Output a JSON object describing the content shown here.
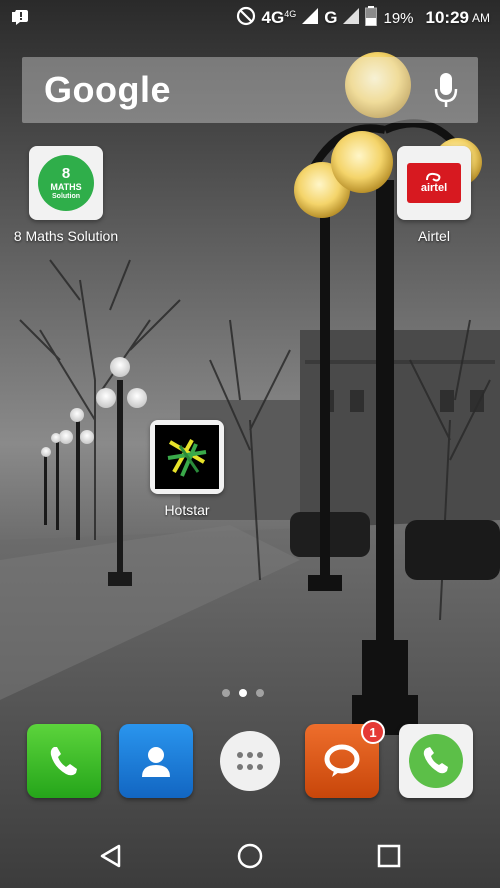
{
  "status_bar": {
    "network_4g_small": "4G",
    "network_4g_superscript": "4G",
    "network_g": "G",
    "battery_percent": "19%",
    "time": "10:29",
    "ampm": "AM"
  },
  "search": {
    "brand": "Google"
  },
  "apps": {
    "maths": {
      "label": "8 Maths Solution",
      "icon_number": "8",
      "icon_text1": "MATHS",
      "icon_text2": "Solution"
    },
    "airtel": {
      "label": "Airtel",
      "icon_text": "airtel"
    },
    "hotstar": {
      "label": "Hotstar"
    }
  },
  "dock": {
    "messages_badge": "1"
  },
  "colors": {
    "maths_green": "#2fae4a",
    "airtel_red": "#d71920",
    "phone_green": "#36b52c",
    "contacts_blue": "#1e7fd6",
    "messages_orange": "#e05a16",
    "call_app_green": "#5cbf48"
  },
  "icons": [
    "notification-icon",
    "dnd-icon",
    "signal-icon",
    "battery-icon",
    "mic-icon",
    "phone-icon",
    "contacts-icon",
    "app-drawer-icon",
    "messages-icon",
    "call-icon",
    "back-icon",
    "home-icon",
    "recents-icon"
  ]
}
